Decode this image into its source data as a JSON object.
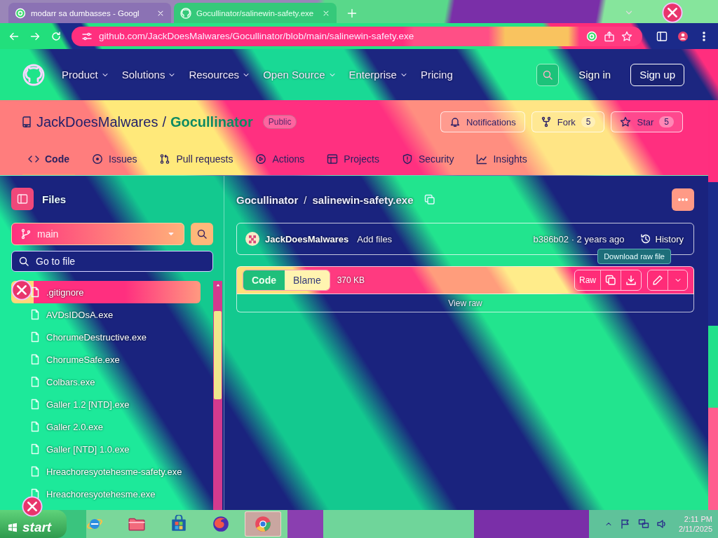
{
  "browser": {
    "tabs": [
      {
        "title": "modarr sa dumbasses - Googl",
        "selected": false
      },
      {
        "title": "Gocullinator/salinewin-safety.exe",
        "selected": true
      }
    ],
    "url": "github.com/JackDoesMalwares/Gocullinator/blob/main/salinewin-safety.exe"
  },
  "site_header": {
    "nav": [
      {
        "label": "Product",
        "has_menu": true
      },
      {
        "label": "Solutions",
        "has_menu": true
      },
      {
        "label": "Resources",
        "has_menu": true
      },
      {
        "label": "Open Source",
        "has_menu": true
      },
      {
        "label": "Enterprise",
        "has_menu": true
      },
      {
        "label": "Pricing",
        "has_menu": false
      }
    ],
    "sign_in": "Sign in",
    "sign_up": "Sign up"
  },
  "repo": {
    "owner": "JackDoesMalwares",
    "separator": "/",
    "name": "Gocullinator",
    "visibility": "Public",
    "actions": [
      {
        "kind": "notifications",
        "label": "Notifications"
      },
      {
        "kind": "fork",
        "label": "Fork",
        "count": "5"
      },
      {
        "kind": "star",
        "label": "Star",
        "count": "5"
      }
    ],
    "tabs": [
      {
        "kind": "code",
        "label": "Code",
        "selected": true
      },
      {
        "kind": "issues",
        "label": "Issues",
        "selected": false
      },
      {
        "kind": "pulls",
        "label": "Pull requests",
        "selected": false
      },
      {
        "kind": "actions",
        "label": "Actions",
        "selected": false
      },
      {
        "kind": "projects",
        "label": "Projects",
        "selected": false
      },
      {
        "kind": "security",
        "label": "Security",
        "selected": false
      },
      {
        "kind": "insights",
        "label": "Insights",
        "selected": false
      }
    ]
  },
  "sidebar": {
    "title": "Files",
    "branch": "main",
    "search": {
      "placeholder": "Go to file"
    },
    "files": [
      {
        "name": ".gitignore",
        "selected": true
      },
      {
        "name": "AVDsIDOsA.exe",
        "selected": false
      },
      {
        "name": "ChorumeDestructive.exe",
        "selected": false
      },
      {
        "name": "ChorumeSafe.exe",
        "selected": false
      },
      {
        "name": "Colbars.exe",
        "selected": false
      },
      {
        "name": "Galler 1.2 [NTD].exe",
        "selected": false
      },
      {
        "name": "Galler 2.0.exe",
        "selected": false
      },
      {
        "name": "Galler [NTD] 1.0.exe",
        "selected": false
      },
      {
        "name": "Hreachoresyotehesme-safety.exe",
        "selected": false
      },
      {
        "name": "Hreachoresyotehesme.exe",
        "selected": false
      }
    ]
  },
  "file_view": {
    "path": {
      "repo": "Gocullinator",
      "separator": "/",
      "file": "salinewin-safety.exe"
    },
    "commit": {
      "author": "JackDoesMalwares",
      "message": "Add files",
      "meta": "b386b02 · 2 years ago",
      "history": "History"
    },
    "tooltip": "Download raw file",
    "view_modes": [
      {
        "label": "Code",
        "selected": true
      },
      {
        "label": "Blame",
        "selected": false
      }
    ],
    "size": "370 KB",
    "raw": "Raw",
    "view_raw": "View raw"
  },
  "taskbar": {
    "start": "start",
    "apps": [
      {
        "kind": "ie",
        "selected": false
      },
      {
        "kind": "folder",
        "selected": false
      },
      {
        "kind": "store",
        "selected": false
      },
      {
        "kind": "firefox",
        "selected": false
      },
      {
        "kind": "chrome",
        "selected": true
      }
    ],
    "time": "2:11 PM",
    "date": "2/11/2025"
  }
}
